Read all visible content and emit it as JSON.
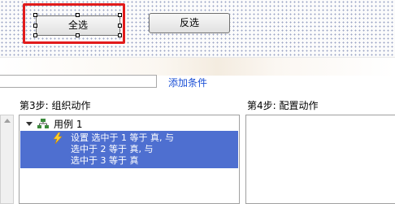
{
  "canvas": {
    "select_all_label": "全选",
    "invert_label": "反选"
  },
  "conditions": {
    "add_condition_link": "添加条件"
  },
  "steps": {
    "step3_label": "第3步: 组织动作",
    "step4_label": "第4步: 配置动作"
  },
  "actions_tree": {
    "case_label": "用例 1",
    "action_lines": [
      "设置 选中于 1 等于 真, 与",
      "选中于 2 等于 真, 与",
      "选中于 3 等于 真"
    ]
  },
  "colors": {
    "highlight": "#e11b1b",
    "selection": "#4e6fd0",
    "link": "#1a4fd6"
  }
}
